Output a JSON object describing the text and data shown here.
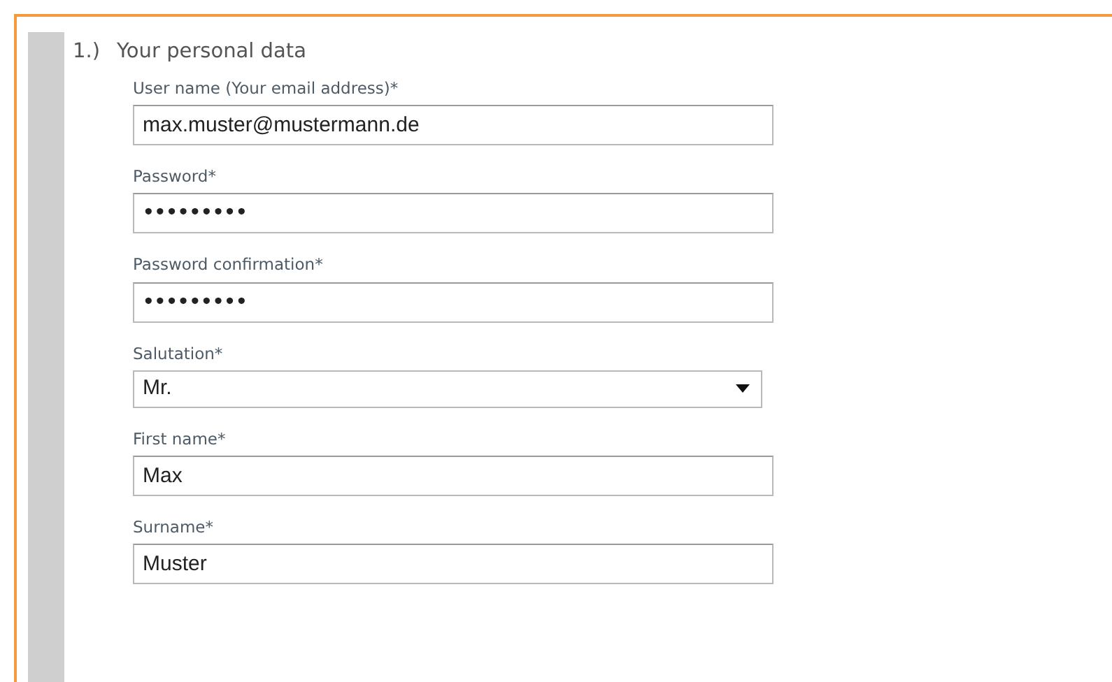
{
  "section": {
    "number": "1.)",
    "title": "Your personal data"
  },
  "fields": [
    {
      "kind": "text",
      "label": "User name (Your email address)*",
      "value": "max.muster@mustermann.de"
    },
    {
      "kind": "password",
      "label": "Password*",
      "value": "•••••••••"
    },
    {
      "kind": "password",
      "label": "Password confirmation*",
      "value": "•••••••••"
    },
    {
      "kind": "select",
      "label": "Salutation*",
      "value": "Mr."
    },
    {
      "kind": "text",
      "label": "First name*",
      "value": "Max"
    },
    {
      "kind": "text",
      "label": "Surname*",
      "value": "Muster"
    }
  ]
}
